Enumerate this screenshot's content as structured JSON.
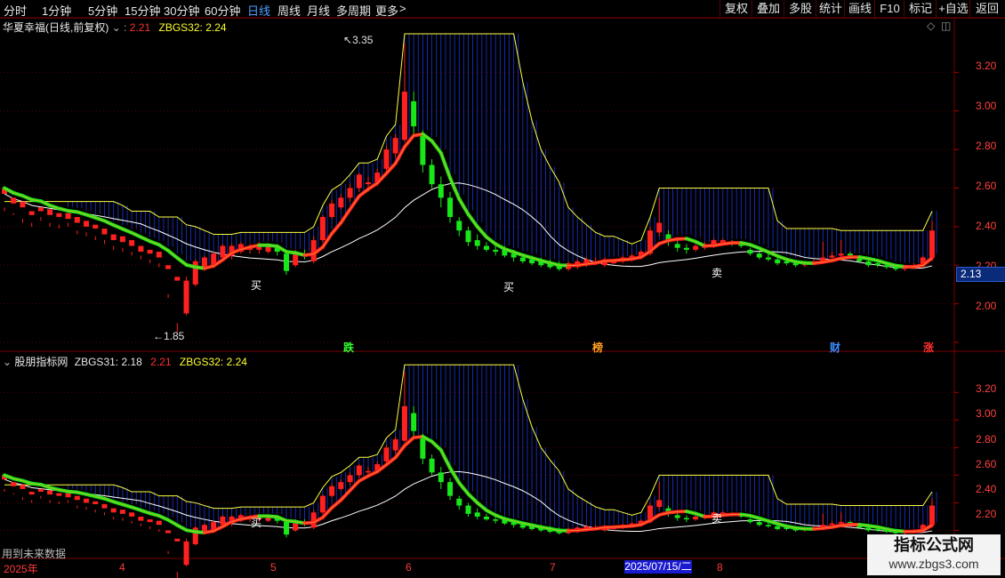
{
  "toolbar": {
    "periods": [
      "分时",
      "1分钟",
      "5分钟",
      "15分钟",
      "30分钟",
      "60分钟",
      "日线",
      "周线",
      "月线",
      "多周期",
      "更多"
    ],
    "active_period": "日线",
    "more_arrow": ">",
    "right_buttons": [
      "复权",
      "叠加",
      "多股",
      "统计",
      "画线",
      "F10",
      "标记",
      "+自选",
      "返回"
    ]
  },
  "main_panel": {
    "stock_name": "华夏幸福",
    "period_desc": "(日线,前复权)",
    "close_value": "2.21",
    "zbgs32_label": "ZBGS32:",
    "zbgs32_value": "2.24",
    "high_marker": "3.35",
    "low_marker": "1.85",
    "price_labels": [
      "3.20",
      "3.00",
      "2.80",
      "2.60",
      "2.40",
      "2.20",
      "2.00"
    ],
    "current_price": "2.13",
    "event_tags": [
      "跌",
      "榜",
      "财",
      "涨"
    ]
  },
  "sub_panel": {
    "title": "股朋指标网",
    "zbgs31_label": "ZBGS31:",
    "zbgs31_value": "2.18",
    "close_value": "2.21",
    "zbgs32_label": "ZBGS32:",
    "zbgs32_value": "2.24",
    "price_labels": [
      "3.20",
      "3.00",
      "2.80",
      "2.60",
      "2.40",
      "2.20"
    ],
    "footer_note": "用到未来数据"
  },
  "signals": {
    "buy": "买",
    "sell": "卖",
    "sell_b": "卖"
  },
  "time_axis": {
    "labels": [
      "2025年",
      "4",
      "5",
      "6",
      "7",
      "8"
    ],
    "highlight_date": "2025/07/15/二"
  },
  "watermark": {
    "line1": "指标公式网",
    "line2": "www.zbgs3.com"
  },
  "colors": {
    "up": "#ff2020",
    "down": "#19e619",
    "blue_band": "#2040ff",
    "yellow_line": "#ffff40",
    "white_line": "#ffffff",
    "axis": "#7a0000"
  },
  "chart_data": {
    "type": "candlestick",
    "ylim_main": [
      1.8,
      3.4
    ],
    "ylim_sub": [
      2.1,
      3.35
    ],
    "candles": [
      [
        2.57,
        2.6,
        2.5,
        2.48
      ],
      [
        2.52,
        2.55,
        2.47,
        2.46
      ],
      [
        2.5,
        2.53,
        2.44,
        2.42
      ],
      [
        2.46,
        2.48,
        2.42,
        2.4
      ],
      [
        2.48,
        2.5,
        2.45,
        2.43
      ],
      [
        2.46,
        2.49,
        2.42,
        2.4
      ],
      [
        2.45,
        2.47,
        2.41,
        2.39
      ],
      [
        2.44,
        2.47,
        2.42,
        2.4
      ],
      [
        2.42,
        2.45,
        2.38,
        2.36
      ],
      [
        2.4,
        2.43,
        2.37,
        2.35
      ],
      [
        2.39,
        2.41,
        2.35,
        2.33
      ],
      [
        2.36,
        2.39,
        2.33,
        2.31
      ],
      [
        2.33,
        2.36,
        2.3,
        2.28
      ],
      [
        2.32,
        2.35,
        2.29,
        2.27
      ],
      [
        2.3,
        2.33,
        2.27,
        2.25
      ],
      [
        2.27,
        2.3,
        2.25,
        2.23
      ],
      [
        2.26,
        2.28,
        2.23,
        2.21
      ],
      [
        2.24,
        2.27,
        2.21,
        2.19
      ],
      [
        2.18,
        2.2,
        2.05,
        2.03
      ],
      [
        2.12,
        2.14,
        1.9,
        1.85
      ],
      [
        1.95,
        2.12,
        1.94,
        2.14
      ],
      [
        2.1,
        2.22,
        2.09,
        2.23
      ],
      [
        2.18,
        2.24,
        2.17,
        2.25
      ],
      [
        2.2,
        2.26,
        2.19,
        2.27
      ],
      [
        2.24,
        2.3,
        2.23,
        2.31
      ],
      [
        2.25,
        2.3,
        2.23,
        2.31
      ],
      [
        2.27,
        2.31,
        2.26,
        2.32
      ],
      [
        2.28,
        2.3,
        2.26,
        2.31
      ],
      [
        2.28,
        2.31,
        2.26,
        2.32
      ],
      [
        2.27,
        2.3,
        2.26,
        2.31
      ],
      [
        2.29,
        2.27,
        2.25,
        2.31
      ],
      [
        2.26,
        2.17,
        2.15,
        2.28
      ],
      [
        2.2,
        2.27,
        2.19,
        2.28
      ],
      [
        2.26,
        2.25,
        2.23,
        2.28
      ],
      [
        2.22,
        2.33,
        2.21,
        2.35
      ],
      [
        2.33,
        2.45,
        2.32,
        2.46
      ],
      [
        2.45,
        2.52,
        2.44,
        2.54
      ],
      [
        2.5,
        2.55,
        2.49,
        2.57
      ],
      [
        2.55,
        2.6,
        2.53,
        2.62
      ],
      [
        2.6,
        2.67,
        2.58,
        2.68
      ],
      [
        2.62,
        2.63,
        2.58,
        2.66
      ],
      [
        2.63,
        2.68,
        2.61,
        2.7
      ],
      [
        2.7,
        2.8,
        2.68,
        2.82
      ],
      [
        2.78,
        2.86,
        2.76,
        2.88
      ],
      [
        2.85,
        3.1,
        2.84,
        3.35
      ],
      [
        3.05,
        2.92,
        2.88,
        3.1
      ],
      [
        2.88,
        2.72,
        2.68,
        2.9
      ],
      [
        2.72,
        2.62,
        2.6,
        2.75
      ],
      [
        2.62,
        2.55,
        2.5,
        2.66
      ],
      [
        2.55,
        2.45,
        2.42,
        2.58
      ],
      [
        2.43,
        2.38,
        2.35,
        2.45
      ],
      [
        2.38,
        2.32,
        2.3,
        2.4
      ],
      [
        2.33,
        2.3,
        2.28,
        2.36
      ],
      [
        2.3,
        2.28,
        2.27,
        2.32
      ],
      [
        2.28,
        2.27,
        2.25,
        2.3
      ],
      [
        2.28,
        2.25,
        2.24,
        2.3
      ],
      [
        2.26,
        2.24,
        2.22,
        2.28
      ],
      [
        2.24,
        2.22,
        2.21,
        2.26
      ],
      [
        2.23,
        2.21,
        2.2,
        2.25
      ],
      [
        2.22,
        2.2,
        2.19,
        2.24
      ],
      [
        2.21,
        2.19,
        2.18,
        2.23
      ],
      [
        2.2,
        2.18,
        2.17,
        2.22
      ],
      [
        2.18,
        2.21,
        2.17,
        2.22
      ],
      [
        2.19,
        2.22,
        2.18,
        2.23
      ],
      [
        2.2,
        2.23,
        2.19,
        2.24
      ],
      [
        2.21,
        2.22,
        2.2,
        2.24
      ],
      [
        2.2,
        2.23,
        2.19,
        2.24
      ],
      [
        2.21,
        2.22,
        2.2,
        2.23
      ],
      [
        2.22,
        2.24,
        2.21,
        2.25
      ],
      [
        2.23,
        2.25,
        2.22,
        2.26
      ],
      [
        2.24,
        2.27,
        2.23,
        2.28
      ],
      [
        2.26,
        2.38,
        2.25,
        2.4
      ],
      [
        2.37,
        2.42,
        2.35,
        2.55
      ],
      [
        2.36,
        2.32,
        2.3,
        2.38
      ],
      [
        2.31,
        2.29,
        2.27,
        2.33
      ],
      [
        2.29,
        2.28,
        2.26,
        2.31
      ],
      [
        2.28,
        2.3,
        2.27,
        2.31
      ],
      [
        2.29,
        2.31,
        2.28,
        2.32
      ],
      [
        2.3,
        2.33,
        2.29,
        2.34
      ],
      [
        2.31,
        2.33,
        2.3,
        2.34
      ],
      [
        2.32,
        2.31,
        2.3,
        2.33
      ],
      [
        2.31,
        2.3,
        2.29,
        2.32
      ],
      [
        2.28,
        2.26,
        2.25,
        2.29
      ],
      [
        2.26,
        2.24,
        2.23,
        2.27
      ],
      [
        2.24,
        2.23,
        2.22,
        2.26
      ],
      [
        2.23,
        2.21,
        2.2,
        2.24
      ],
      [
        2.22,
        2.21,
        2.2,
        2.23
      ],
      [
        2.21,
        2.2,
        2.19,
        2.22
      ],
      [
        2.2,
        2.21,
        2.19,
        2.22
      ],
      [
        2.21,
        2.22,
        2.2,
        2.23
      ],
      [
        2.22,
        2.24,
        2.21,
        2.32
      ],
      [
        2.24,
        2.25,
        2.23,
        2.27
      ],
      [
        2.25,
        2.26,
        2.24,
        2.33
      ],
      [
        2.26,
        2.24,
        2.23,
        2.27
      ],
      [
        2.24,
        2.22,
        2.21,
        2.25
      ],
      [
        2.22,
        2.2,
        2.19,
        2.23
      ],
      [
        2.21,
        2.2,
        2.19,
        2.22
      ],
      [
        2.2,
        2.19,
        2.18,
        2.21
      ],
      [
        2.19,
        2.18,
        2.17,
        2.2
      ],
      [
        2.18,
        2.19,
        2.17,
        2.2
      ],
      [
        2.19,
        2.2,
        2.18,
        2.21
      ],
      [
        2.2,
        2.24,
        2.19,
        2.25
      ],
      [
        2.24,
        2.38,
        2.22,
        2.43
      ]
    ]
  }
}
